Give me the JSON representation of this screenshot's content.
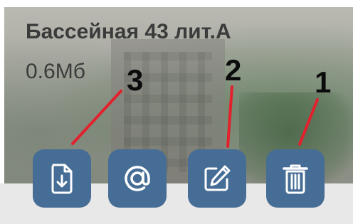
{
  "card": {
    "title": "Бассейная 43 лит.А",
    "size": "0.6Мб"
  },
  "actions": [
    {
      "id": "download",
      "icon": "download-file-icon"
    },
    {
      "id": "email",
      "icon": "at-sign-icon"
    },
    {
      "id": "edit",
      "icon": "pencil-edit-icon"
    },
    {
      "id": "delete",
      "icon": "trash-icon"
    }
  ],
  "callouts": {
    "delete": "1",
    "edit": "2",
    "download": "3"
  },
  "colors": {
    "button_bg": "#466d95",
    "icon": "#ffffff",
    "callout_line": "#e2212d",
    "text": "#3b3b3b"
  }
}
